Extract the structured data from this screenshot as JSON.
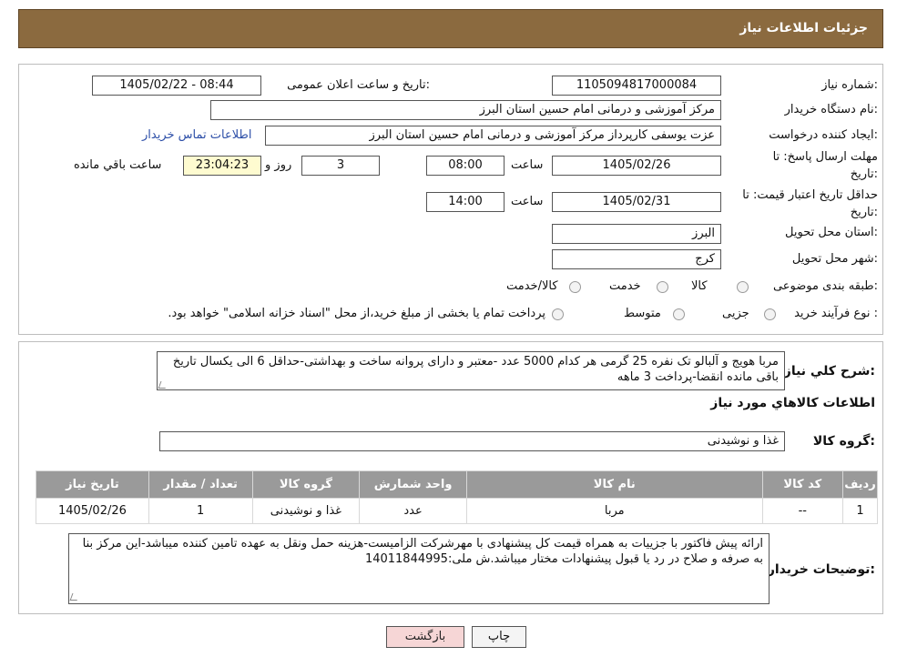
{
  "header": {
    "title": "جزئیات اطلاعات نیاز"
  },
  "form": {
    "need_number_label": "شماره نیاز:",
    "need_number": "1105094817000084",
    "announce_label": "تاریخ و ساعت اعلان عمومی:",
    "announce_value": "1405/02/22 - 08:44",
    "buyer_org_label": "نام دستگاه خریدار:",
    "buyer_org": "مرکز آموزشی و درمانی امام حسین استان البرز",
    "creator_label": "ایجاد کننده درخواست:",
    "creator": "عزت یوسفی کارپرداز مرکز آموزشی و درمانی امام حسین استان البرز",
    "contact_link": "اطلاعات تماس خریدار",
    "reply_deadline_label_1": "مهلت ارسال پاسخ: تا",
    "reply_deadline_label_2": "تاریخ:",
    "reply_date": "1405/02/26",
    "time_label": "ساعت",
    "reply_time": "08:00",
    "days_count": "3",
    "days_label": "روز و",
    "remaining_time": "23:04:23",
    "remaining_label": "ساعت باقي مانده",
    "validity_label_1": "حداقل تاریخ اعتبار قیمت: تا",
    "validity_label_2": "تاریخ:",
    "validity_date": "1405/02/31",
    "validity_time": "14:00",
    "province_label": "استان محل تحویل:",
    "province": "البرز",
    "city_label": "شهر محل تحویل:",
    "city": "کرج",
    "category_label": "طبقه بندی موضوعی:",
    "category_options": [
      "کالا",
      "خدمت",
      "کالا/خدمت"
    ],
    "process_label": "نوع فرآیند خرید :",
    "process_options": [
      "جزیی",
      "متوسط"
    ],
    "process_note": "پرداخت تمام یا بخشی از مبلغ خرید،از محل \"اسناد خزانه اسلامی\" خواهد بود."
  },
  "summary": {
    "general_desc_label": "شرح کلي نياز:",
    "general_desc": "مربا هویج و آلبالو تک نفره 25 گرمی هر کدام 5000 عدد -معتبر و دارای پروانه ساخت و بهداشتی-حداقل 6 الی یکسال تاریخ باقی مانده انقضا-پرداخت 3 ماهه",
    "goods_info_title": "اطلاعات کالاهاي مورد نياز",
    "goods_group_label": "گروه کالا:",
    "goods_group": "غذا و نوشیدنی",
    "table": {
      "headers": [
        "رديف",
        "کد کالا",
        "نام کالا",
        "واحد شمارش",
        "گروه کالا",
        "تعداد / مقدار",
        "تاریخ نیاز"
      ],
      "rows": [
        [
          "1",
          "--",
          "مربا",
          "عدد",
          "غذا و نوشیدنی",
          "1",
          "1405/02/26"
        ]
      ]
    },
    "buyer_notes_label": "توضیحات خریدار:",
    "buyer_notes": "ارائه پیش فاکتور با جزییات به همراه قیمت کل پیشنهادی با مهرشرکت الزامیست-هزینه حمل ونقل به عهده تامین کننده میباشد-این مرکز بنا به صرفه و صلاح در رد یا قبول پیشنهادات مختار میباشد.ش ملی:14011844995"
  },
  "buttons": {
    "print": "چاپ",
    "back": "بازگشت"
  },
  "colors": {
    "header_bg": "#8b6a3f",
    "table_header_bg": "#9a9a9a",
    "back_button_bg": "#f6d6d6",
    "remaining_bg": "#fefbd0"
  }
}
